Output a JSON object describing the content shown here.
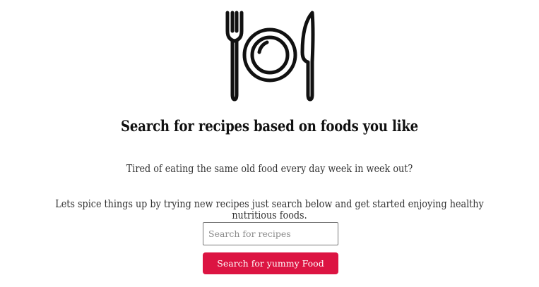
{
  "header": {
    "logo_icon": "plate-fork-knife-icon"
  },
  "main": {
    "headline": "Search for recipes based on foods you like",
    "tagline_1": "Tired of eating the same old food every day week in week out?",
    "tagline_2": "Lets spice things up by trying new recipes just search below and get started enjoying healthy nutritious foods."
  },
  "search": {
    "value": "",
    "placeholder": "Search for recipes",
    "button_label": "Search for yummy Food"
  },
  "colors": {
    "accent": "#dc1442",
    "text": "#222222",
    "background": "#ffffff"
  }
}
